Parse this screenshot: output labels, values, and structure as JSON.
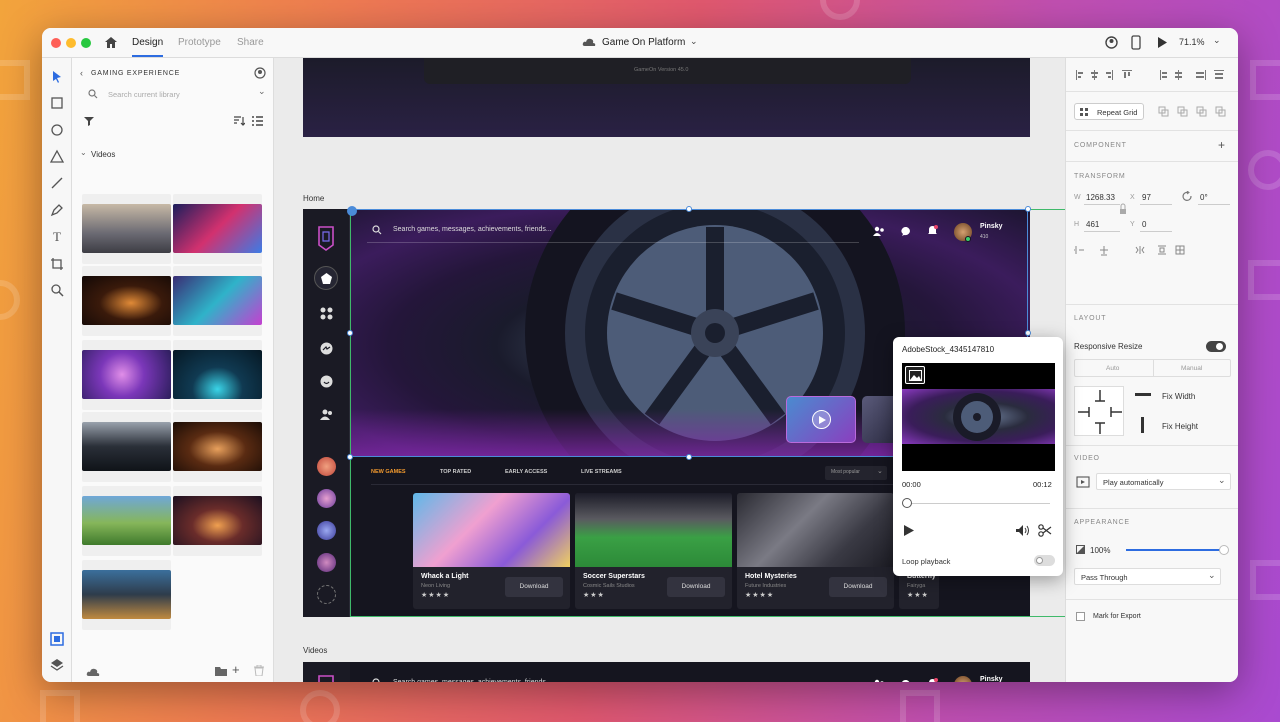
{
  "window": {
    "title": "Game On Platform",
    "zoom": "71.1%"
  },
  "tabs": [
    {
      "label": "Design"
    },
    {
      "label": "Prototype"
    },
    {
      "label": "Share"
    }
  ],
  "library": {
    "title": "GAMING EXPERIENCE",
    "search_placeholder": "Search current library",
    "section": "Videos"
  },
  "canvas": {
    "top_artboard_text": "GameOn Version 45.0",
    "home_label": "Home",
    "videos_label": "Videos"
  },
  "app": {
    "search_placeholder": "Search games, messages, achievements, friends...",
    "user": {
      "name": "Pinsky",
      "xp": "410"
    },
    "tabs": [
      "NEW GAMES",
      "TOP RATED",
      "EARLY ACCESS",
      "LIVE STREAMS"
    ],
    "sort": "Most popular",
    "cards": [
      {
        "title": "Whack a Light",
        "studio": "Neon Living",
        "stars": "★★★★",
        "button": "Download"
      },
      {
        "title": "Soccer Superstars",
        "studio": "Cosmic Sails Studios",
        "stars": "★★★",
        "button": "Download"
      },
      {
        "title": "Hotel Mysteries",
        "studio": "Future Industries",
        "stars": "★★★★",
        "button": "Download"
      },
      {
        "title": "Butterfly",
        "studio": "Fairyga",
        "stars": "★★★",
        "button": ""
      }
    ]
  },
  "video_popup": {
    "filename": "AdobeStock_4345147810",
    "time_start": "00:00",
    "time_end": "00:12",
    "progress": 0.0,
    "loop_label": "Loop playback"
  },
  "inspector": {
    "repeat_grid": "Repeat Grid",
    "component": "COMPONENT",
    "transform": "TRANSFORM",
    "w_label": "W",
    "w": "1268.33",
    "x_label": "X",
    "x": "97",
    "rotation": "0°",
    "h_label": "H",
    "h": "461",
    "y_label": "Y",
    "y": "0",
    "layout": "LAYOUT",
    "responsive_resize": "Responsive Resize",
    "auto": "Auto",
    "manual": "Manual",
    "fix_width": "Fix Width",
    "fix_height": "Fix Height",
    "video": "VIDEO",
    "video_option": "Play automatically",
    "appearance": "APPEARANCE",
    "opacity": "100%",
    "opacity_value": 1.0,
    "blend": "Pass Through",
    "mark_export": "Mark for Export"
  },
  "colors": {
    "accent": "#2d6ce0",
    "highlight_tab": "#f39a2e",
    "canvas_dark": "#15151f"
  }
}
